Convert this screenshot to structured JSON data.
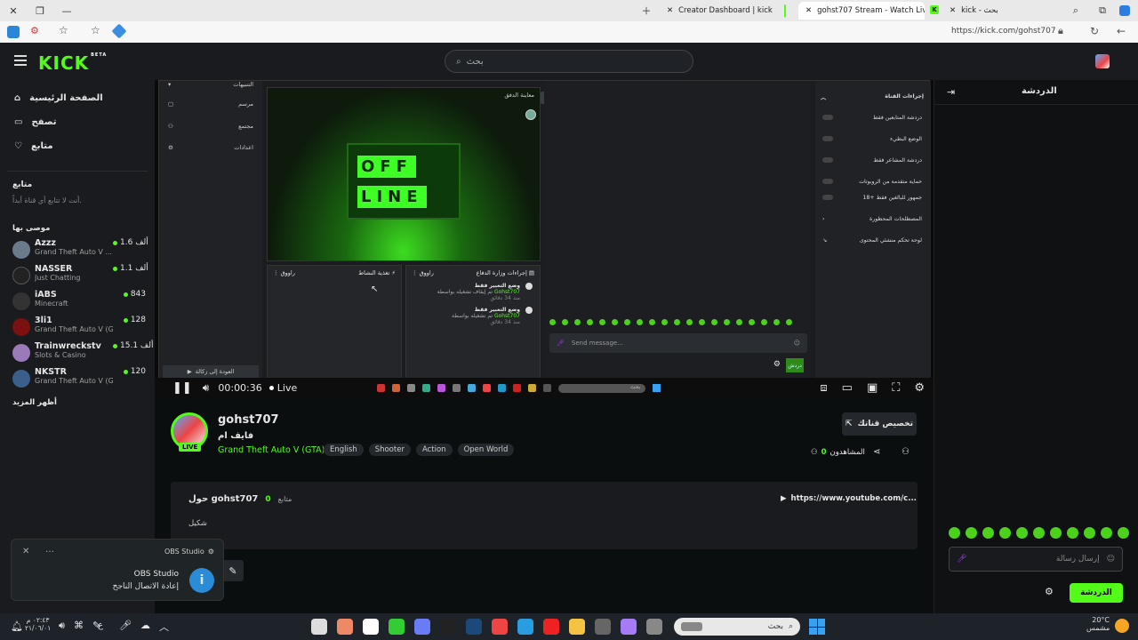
{
  "browser": {
    "tabs": [
      {
        "label": "Creator Dashboard | kick"
      },
      {
        "label": "gohst707 Stream - Watch Live on"
      },
      {
        "label": "kick - بحث"
      }
    ],
    "url": "https://kick.com/gohst707"
  },
  "header": {
    "logo": "KICK",
    "beta": "BETA",
    "search_placeholder": "بحث"
  },
  "sidebar": {
    "nav": [
      {
        "label": "الصفحة الرئيسية",
        "icon": "home-icon"
      },
      {
        "label": "تصفح",
        "icon": "browse-icon"
      },
      {
        "label": "متابع",
        "icon": "heart-icon"
      }
    ],
    "following_title": "متابع",
    "following_empty": "أنت لا تتابع أي قناة أبداً.",
    "recommended_title": "موصى بها",
    "channels": [
      {
        "name": "Azzz",
        "game": "Grand Theft Auto V ...",
        "viewers": "1.6 ألف",
        "color": "#6b7b8c"
      },
      {
        "name": "NASSER",
        "game": "Just Chatting",
        "viewers": "1.1 ألف",
        "color": "#222"
      },
      {
        "name": "iABS",
        "game": "Minecraft",
        "viewers": "843",
        "color": "#333"
      },
      {
        "name": "3li1",
        "game": "Grand Theft Auto V (G...",
        "viewers": "128",
        "color": "#7a1010"
      },
      {
        "name": "Trainwreckstv",
        "game": "Slots & Casino",
        "viewers": "15.1 ألف",
        "color": "#9a7ab8"
      },
      {
        "name": "NKSTR",
        "game": "Grand Theft Auto V (G...",
        "viewers": "120",
        "color": "#3a5f8a"
      }
    ],
    "show_more": "أظهر المزيد"
  },
  "player": {
    "offline_top": "OFF",
    "offline_bottom": "LINE",
    "preview_label": "معاينة الدفق",
    "menu": [
      "التنبيهات",
      "مرسم",
      "مجتمع",
      "اعدادات"
    ],
    "back_label": "العودة إلى زكالة",
    "activity_label": "تغذية النشاط",
    "activity_user": "راووق",
    "mod_label": "إجراءات وزارة الدفاع",
    "mod_user": "راووق",
    "mod_items": [
      {
        "title": "وضع التعبير فقط",
        "sub": "تم إيقاف تشغيله بواسطة",
        "by": "Gohst707",
        "ago": "منذ 34 دقائق"
      },
      {
        "title": "وضع التعبير فقط",
        "sub": "تم تشغيله بواسطة",
        "by": "Gohst707",
        "ago": "منذ 34 دقائق"
      }
    ],
    "send_placeholder": "Send message...",
    "chat_btn": "دردش",
    "settings_title": "إجراءات القناة",
    "settings": [
      "دردشة المتابعين فقط",
      "الوضع البطيء",
      "دردشة المشاعر فقط",
      "حماية متقدمة من الروبوتات",
      "18+ جمهور للبالغين فقط",
      "المصطلحات المحظورة",
      "لوحة تحكم منشئي المحتوى"
    ],
    "time": "00:00:36",
    "live": "Live",
    "taskbar_search": "بحث"
  },
  "stream": {
    "username": "gohst707",
    "title": "فايف ام",
    "category": "Grand Theft Auto V (GTA)",
    "tags": [
      "English",
      "Shooter",
      "Action",
      "Open World"
    ],
    "live_badge": "LIVE",
    "customize": "تخصيص قناتك",
    "viewers_label": "المشاهدون",
    "viewers": "0"
  },
  "about": {
    "title": "حول gohst707",
    "followers_count": "0",
    "followers_label": "متابع",
    "desc": "شكيل",
    "link": "https://www.youtube.com/c..."
  },
  "chat": {
    "title": "الدردشة",
    "placeholder": "إرسال رسالة",
    "send": "الدردشة"
  },
  "toast": {
    "app": "OBS Studio",
    "title": "OBS Studio",
    "message": "إعادة الاتصال الناجح"
  },
  "taskbar": {
    "search": "بحث",
    "time": "٠٢:٤٣ م",
    "date": "٢١/٠٦/٠١",
    "temp": "20°C",
    "weather": "مشمس",
    "lang": "ع"
  },
  "colors": {
    "accent": "#53fc18",
    "bg": "#0b0e0f",
    "panel": "#191b1f"
  }
}
